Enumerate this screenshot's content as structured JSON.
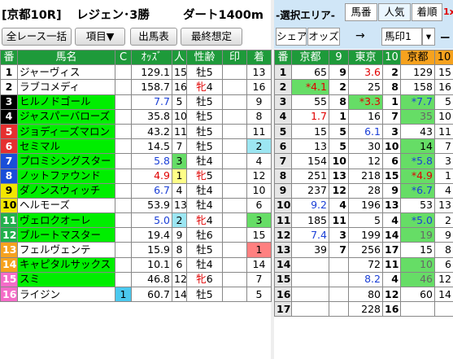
{
  "title": {
    "race": "[京都10R]",
    "name": "レジェン･3勝",
    "course": "ダート1400m"
  },
  "toolbar": {
    "all_races": "全レース一括",
    "items": "項目▼",
    "entries": "出馬表",
    "final": "最終想定"
  },
  "area": {
    "label": "-選択エリア-",
    "tab_umaban": "馬番",
    "tab_ninki": "人気",
    "tab_chakujun": "着順",
    "tab_extra": "1x",
    "share": "シェア",
    "odds": "オッズ",
    "arrow": "→",
    "mark": "馬印1",
    "dropdown": "▾",
    "dash": "ー"
  },
  "left_headers": [
    "番",
    "馬名",
    "C",
    "ｵｯｽﾞ",
    "人",
    "性齢",
    "印",
    "着"
  ],
  "horses": [
    {
      "no": "1",
      "name": "ジャーヴィス",
      "c": "",
      "odds": "129.1",
      "pop": "15",
      "sex": "牡",
      "age": "5",
      "mark": "",
      "finish": "13",
      "no_bg": "#ffffff",
      "no_fg": "#000000",
      "name_bg": "#ffffff",
      "c_bg": "",
      "pop_bg": "",
      "mark_bg": "",
      "fin_bg": "",
      "odds_color": "#000000",
      "sex_color": "#000000"
    },
    {
      "no": "2",
      "name": "ラブコメディ",
      "c": "",
      "odds": "158.7",
      "pop": "16",
      "sex": "牝",
      "age": "4",
      "mark": "",
      "finish": "16",
      "no_bg": "#ffffff",
      "no_fg": "#000000",
      "name_bg": "#ffffff",
      "c_bg": "",
      "pop_bg": "",
      "mark_bg": "",
      "fin_bg": "",
      "odds_color": "#000000",
      "sex_color": "#e00000"
    },
    {
      "no": "3",
      "name": "ヒルノドゴール",
      "c": "",
      "odds": "7.7",
      "pop": "5",
      "sex": "牡",
      "age": "5",
      "mark": "",
      "finish": "9",
      "no_bg": "#000000",
      "no_fg": "#ffffff",
      "name_bg": "#00ee00",
      "c_bg": "",
      "pop_bg": "",
      "mark_bg": "",
      "fin_bg": "",
      "odds_color": "#1a3fd6",
      "sex_color": "#000000"
    },
    {
      "no": "4",
      "name": "ジャスパーバローズ",
      "c": "",
      "odds": "35.8",
      "pop": "10",
      "sex": "牡",
      "age": "5",
      "mark": "",
      "finish": "8",
      "no_bg": "#000000",
      "no_fg": "#ffffff",
      "name_bg": "#00ee00",
      "c_bg": "",
      "pop_bg": "",
      "mark_bg": "",
      "fin_bg": "",
      "odds_color": "#000000",
      "sex_color": "#000000"
    },
    {
      "no": "5",
      "name": "ジョディーズマロン",
      "c": "",
      "odds": "43.2",
      "pop": "11",
      "sex": "牡",
      "age": "5",
      "mark": "",
      "finish": "11",
      "no_bg": "#e53030",
      "no_fg": "#ffffff",
      "name_bg": "#00ee00",
      "c_bg": "",
      "pop_bg": "",
      "mark_bg": "",
      "fin_bg": "",
      "odds_color": "#000000",
      "sex_color": "#000000"
    },
    {
      "no": "6",
      "name": "セミマル",
      "c": "",
      "odds": "14.5",
      "pop": "7",
      "sex": "牡",
      "age": "5",
      "mark": "",
      "finish": "2",
      "no_bg": "#e53030",
      "no_fg": "#ffffff",
      "name_bg": "#00ee00",
      "c_bg": "",
      "pop_bg": "",
      "mark_bg": "",
      "fin_bg": "#9ce6f2",
      "odds_color": "#000000",
      "sex_color": "#000000"
    },
    {
      "no": "7",
      "name": "プロミシングスター",
      "c": "",
      "odds": "5.8",
      "pop": "3",
      "sex": "牡",
      "age": "4",
      "mark": "",
      "finish": "4",
      "no_bg": "#1a4ed8",
      "no_fg": "#ffffff",
      "name_bg": "#00ee00",
      "c_bg": "",
      "pop_bg": "#66dd66",
      "mark_bg": "",
      "fin_bg": "",
      "odds_color": "#1a3fd6",
      "sex_color": "#000000"
    },
    {
      "no": "8",
      "name": "ノットファウンド",
      "c": "",
      "odds": "4.9",
      "pop": "1",
      "sex": "牝",
      "age": "5",
      "mark": "",
      "finish": "12",
      "no_bg": "#1a4ed8",
      "no_fg": "#ffffff",
      "name_bg": "#00ee00",
      "c_bg": "",
      "pop_bg": "#ffff88",
      "mark_bg": "",
      "fin_bg": "",
      "odds_color": "#e00000",
      "sex_color": "#e00000"
    },
    {
      "no": "9",
      "name": "ダノンスウィッチ",
      "c": "",
      "odds": "6.7",
      "pop": "4",
      "sex": "牡",
      "age": "4",
      "mark": "",
      "finish": "10",
      "no_bg": "#f2e600",
      "no_fg": "#000000",
      "name_bg": "#00ee00",
      "c_bg": "",
      "pop_bg": "",
      "mark_bg": "",
      "fin_bg": "",
      "odds_color": "#1a3fd6",
      "sex_color": "#000000"
    },
    {
      "no": "10",
      "name": "ヘルモーズ",
      "c": "",
      "odds": "53.9",
      "pop": "13",
      "sex": "牡",
      "age": "4",
      "mark": "",
      "finish": "6",
      "no_bg": "#f2e600",
      "no_fg": "#000000",
      "name_bg": "#ffffff",
      "c_bg": "",
      "pop_bg": "",
      "mark_bg": "",
      "fin_bg": "",
      "odds_color": "#000000",
      "sex_color": "#000000"
    },
    {
      "no": "11",
      "name": "ヴェロクオーレ",
      "c": "",
      "odds": "5.0",
      "pop": "2",
      "sex": "牝",
      "age": "4",
      "mark": "",
      "finish": "3",
      "no_bg": "#22b14c",
      "no_fg": "#ffffff",
      "name_bg": "#00ee00",
      "c_bg": "",
      "pop_bg": "#9ce6f2",
      "mark_bg": "",
      "fin_bg": "#66dd66",
      "odds_color": "#1a3fd6",
      "sex_color": "#e00000"
    },
    {
      "no": "12",
      "name": "ブルートマスター",
      "c": "",
      "odds": "19.4",
      "pop": "9",
      "sex": "牡",
      "age": "6",
      "mark": "",
      "finish": "15",
      "no_bg": "#22b14c",
      "no_fg": "#ffffff",
      "name_bg": "#00ee00",
      "c_bg": "",
      "pop_bg": "",
      "mark_bg": "",
      "fin_bg": "",
      "odds_color": "#000000",
      "sex_color": "#000000"
    },
    {
      "no": "13",
      "name": "フェルヴェンテ",
      "c": "",
      "odds": "15.9",
      "pop": "8",
      "sex": "牡",
      "age": "5",
      "mark": "",
      "finish": "1",
      "no_bg": "#f6a21e",
      "no_fg": "#ffffff",
      "name_bg": "#ffffff",
      "c_bg": "",
      "pop_bg": "",
      "mark_bg": "",
      "fin_bg": "#ff8080",
      "odds_color": "#000000",
      "sex_color": "#000000"
    },
    {
      "no": "14",
      "name": "キャピタルサックス",
      "c": "",
      "odds": "10.1",
      "pop": "6",
      "sex": "牡",
      "age": "4",
      "mark": "",
      "finish": "14",
      "no_bg": "#f6a21e",
      "no_fg": "#ffffff",
      "name_bg": "#00ee00",
      "c_bg": "",
      "pop_bg": "",
      "mark_bg": "",
      "fin_bg": "",
      "odds_color": "#000000",
      "sex_color": "#000000"
    },
    {
      "no": "15",
      "name": "スミ",
      "c": "",
      "odds": "46.8",
      "pop": "12",
      "sex": "牝",
      "age": "6",
      "mark": "",
      "finish": "7",
      "no_bg": "#f56cc8",
      "no_fg": "#ffffff",
      "name_bg": "#00ee00",
      "c_bg": "",
      "pop_bg": "",
      "mark_bg": "",
      "fin_bg": "",
      "odds_color": "#000000",
      "sex_color": "#e00000"
    },
    {
      "no": "16",
      "name": "ライジン",
      "c": "1",
      "odds": "60.7",
      "pop": "14",
      "sex": "牡",
      "age": "5",
      "mark": "",
      "finish": "5",
      "no_bg": "#f56cc8",
      "no_fg": "#ffffff",
      "name_bg": "#ffffff",
      "c_bg": "#4bc8ee",
      "pop_bg": "",
      "mark_bg": "",
      "fin_bg": "",
      "odds_color": "#000000",
      "sex_color": "#000000"
    }
  ],
  "right_headers": [
    "番",
    "京都",
    "9",
    "東京",
    "10",
    "京都",
    "10"
  ],
  "right_rows": [
    {
      "no": "1",
      "a1": "65",
      "a2": "9",
      "b1": "3.6",
      "b2": "2",
      "c1": "129",
      "c2": "15",
      "a1c": "#000",
      "a1bg": "",
      "b1c": "#e00000",
      "b1bg": "",
      "c1c": "#000",
      "c1bg": ""
    },
    {
      "no": "2",
      "a1": "*4.1",
      "a2": "2",
      "b1": "25",
      "b2": "8",
      "c1": "158",
      "c2": "16",
      "a1c": "#e00000",
      "a1bg": "#66dd66",
      "b1c": "#000",
      "b1bg": "",
      "c1c": "#000",
      "c1bg": ""
    },
    {
      "no": "3",
      "a1": "55",
      "a2": "8",
      "b1": "*3.3",
      "b2": "1",
      "c1": "*7.7",
      "c2": "5",
      "a1c": "#000",
      "a1bg": "",
      "b1c": "#e00000",
      "b1bg": "#66dd66",
      "c1c": "#1a3fd6",
      "c1bg": "#66dd66"
    },
    {
      "no": "4",
      "a1": "1.7",
      "a2": "1",
      "b1": "16",
      "b2": "7",
      "c1": "35",
      "c2": "10",
      "a1c": "#e00000",
      "a1bg": "",
      "b1c": "#000",
      "b1bg": "",
      "c1c": "#666",
      "c1bg": "#66dd66"
    },
    {
      "no": "5",
      "a1": "15",
      "a2": "5",
      "b1": "6.1",
      "b2": "3",
      "c1": "43",
      "c2": "11",
      "a1c": "#000",
      "a1bg": "",
      "b1c": "#1a3fd6",
      "b1bg": "",
      "c1c": "#000",
      "c1bg": ""
    },
    {
      "no": "6",
      "a1": "13",
      "a2": "5",
      "b1": "30",
      "b2": "10",
      "c1": "14",
      "c2": "7",
      "a1c": "#000",
      "a1bg": "",
      "b1c": "#000",
      "b1bg": "",
      "c1c": "#000",
      "c1bg": "#66dd66"
    },
    {
      "no": "7",
      "a1": "154",
      "a2": "10",
      "b1": "12",
      "b2": "6",
      "c1": "*5.8",
      "c2": "3",
      "a1c": "#000",
      "a1bg": "",
      "b1c": "#000",
      "b1bg": "",
      "c1c": "#1a3fd6",
      "c1bg": "#66dd66"
    },
    {
      "no": "8",
      "a1": "251",
      "a2": "13",
      "b1": "218",
      "b2": "15",
      "c1": "*4.9",
      "c2": "1",
      "a1c": "#000",
      "a1bg": "",
      "b1c": "#000",
      "b1bg": "",
      "c1c": "#e00000",
      "c1bg": "#66dd66"
    },
    {
      "no": "9",
      "a1": "237",
      "a2": "12",
      "b1": "28",
      "b2": "9",
      "c1": "*6.7",
      "c2": "4",
      "a1c": "#000",
      "a1bg": "",
      "b1c": "#000",
      "b1bg": "",
      "c1c": "#1a3fd6",
      "c1bg": "#66dd66"
    },
    {
      "no": "10",
      "a1": "9.2",
      "a2": "4",
      "b1": "196",
      "b2": "13",
      "c1": "53",
      "c2": "13",
      "a1c": "#1a3fd6",
      "a1bg": "",
      "b1c": "#000",
      "b1bg": "",
      "c1c": "#000",
      "c1bg": ""
    },
    {
      "no": "11",
      "a1": "185",
      "a2": "11",
      "b1": "5",
      "b2": "4",
      "c1": "*5.0",
      "c2": "2",
      "a1c": "#000",
      "a1bg": "",
      "b1c": "#000",
      "b1bg": "",
      "c1c": "#1a3fd6",
      "c1bg": "#66dd66"
    },
    {
      "no": "12",
      "a1": "7.4",
      "a2": "3",
      "b1": "199",
      "b2": "14",
      "c1": "19",
      "c2": "9",
      "a1c": "#1a3fd6",
      "a1bg": "",
      "b1c": "#000",
      "b1bg": "",
      "c1c": "#666",
      "c1bg": "#66dd66"
    },
    {
      "no": "13",
      "a1": "39",
      "a2": "7",
      "b1": "256",
      "b2": "17",
      "c1": "15",
      "c2": "8",
      "a1c": "#000",
      "a1bg": "",
      "b1c": "#000",
      "b1bg": "",
      "c1c": "#000",
      "c1bg": ""
    },
    {
      "no": "14",
      "a1": "",
      "a2": "",
      "b1": "72",
      "b2": "11",
      "c1": "10",
      "c2": "6",
      "a1c": "#000",
      "a1bg": "",
      "b1c": "#000",
      "b1bg": "",
      "c1c": "#666",
      "c1bg": "#66dd66"
    },
    {
      "no": "15",
      "a1": "",
      "a2": "",
      "b1": "8.2",
      "b2": "4",
      "c1": "46",
      "c2": "12",
      "a1c": "#000",
      "a1bg": "",
      "b1c": "#1a3fd6",
      "b1bg": "",
      "c1c": "#666",
      "c1bg": "#66dd66"
    },
    {
      "no": "16",
      "a1": "",
      "a2": "",
      "b1": "80",
      "b2": "12",
      "c1": "60",
      "c2": "14",
      "a1c": "#000",
      "a1bg": "",
      "b1c": "#000",
      "b1bg": "",
      "c1c": "#000",
      "c1bg": ""
    },
    {
      "no": "17",
      "a1": "",
      "a2": "",
      "b1": "228",
      "b2": "16",
      "c1": "",
      "c2": "",
      "a1c": "#000",
      "a1bg": "",
      "b1c": "#000",
      "b1bg": "",
      "c1c": "#000",
      "c1bg": ""
    }
  ]
}
